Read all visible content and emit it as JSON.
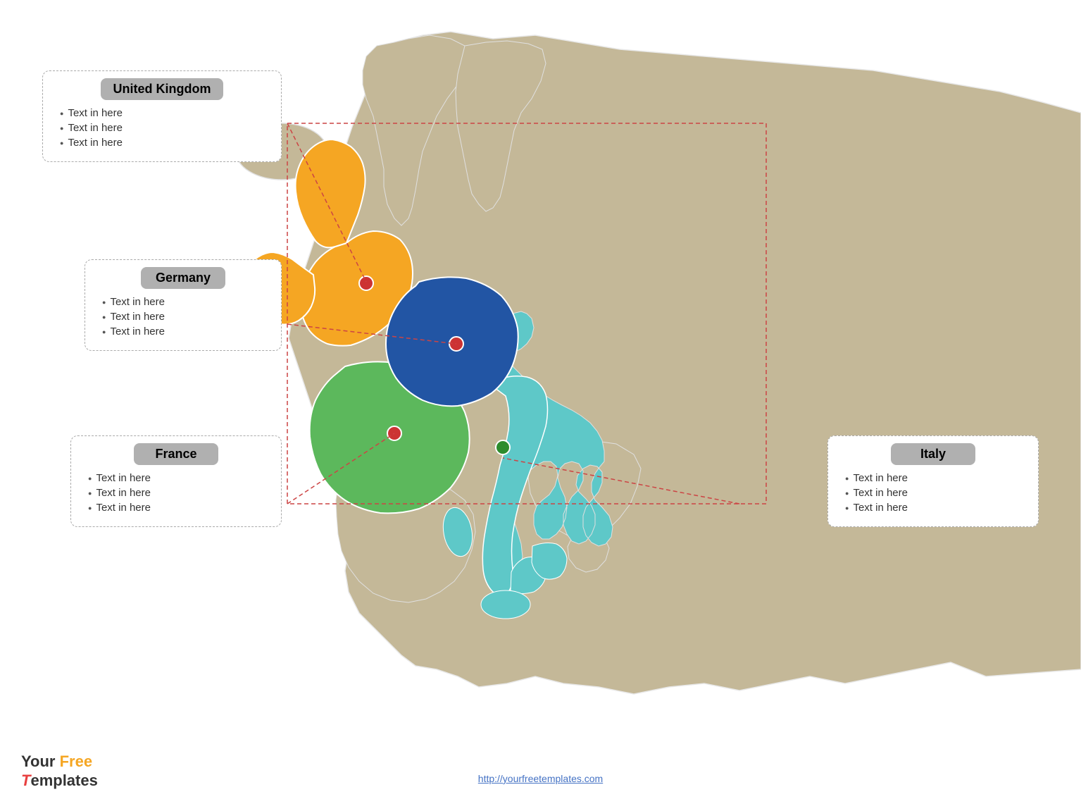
{
  "boxes": {
    "uk": {
      "title": "United Kingdom",
      "items": [
        "Text in here",
        "Text in here",
        "Text in here"
      ]
    },
    "germany": {
      "title": "Germany",
      "items": [
        "Text in here",
        "Text in here",
        "Text in here"
      ]
    },
    "france": {
      "title": "France",
      "items": [
        "Text in here",
        "Text in here",
        "Text in here"
      ]
    },
    "italy": {
      "title": "Italy",
      "items": [
        "Text in here",
        "Text in here",
        "Text in here"
      ]
    }
  },
  "footer": {
    "logo_your": "Your ",
    "logo_free": "Free",
    "logo_templates": "Templates",
    "link_text": "http://yourfreetemplates.com"
  }
}
